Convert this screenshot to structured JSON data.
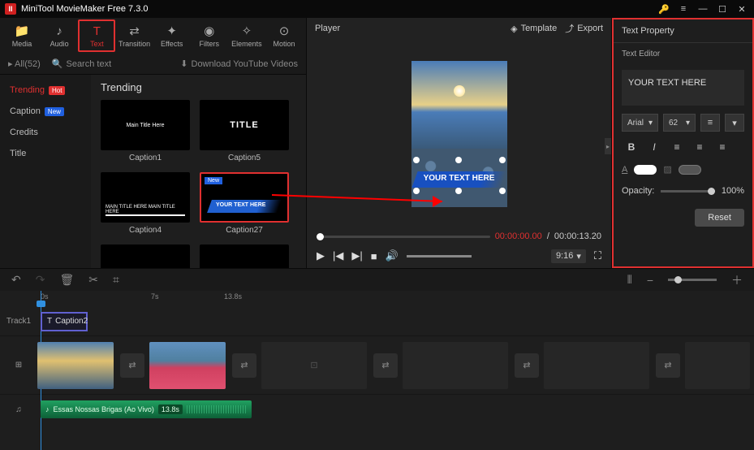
{
  "title": "MiniTool MovieMaker Free 7.3.0",
  "toolbar": [
    {
      "icon": "📁",
      "label": "Media"
    },
    {
      "icon": "♪",
      "label": "Audio"
    },
    {
      "icon": "T",
      "label": "Text"
    },
    {
      "icon": "⇄",
      "label": "Transition"
    },
    {
      "icon": "✦",
      "label": "Effects"
    },
    {
      "icon": "◉",
      "label": "Filters"
    },
    {
      "icon": "✧",
      "label": "Elements"
    },
    {
      "icon": "⊙",
      "label": "Motion"
    }
  ],
  "subbar": {
    "all": "All(52)",
    "search": "Search text",
    "dyt": "Download YouTube Videos"
  },
  "cats": [
    {
      "label": "Trending",
      "badge": "Hot",
      "badgeClass": "hot",
      "active": true
    },
    {
      "label": "Caption",
      "badge": "New",
      "badgeClass": "new"
    },
    {
      "label": "Credits"
    },
    {
      "label": "Title"
    }
  ],
  "libTitle": "Trending",
  "templates": {
    "c1": "Caption1",
    "c5": "Caption5",
    "c4": "Caption4",
    "c27": "Caption27",
    "newTag": "New",
    "bannerText": "YOUR TEXT HERE",
    "titleText": "TITLE"
  },
  "player": {
    "label": "Player",
    "template": "Template",
    "export": "Export",
    "overlayText": "YOUR TEXT HERE",
    "timeCur": "00:00:00.00",
    "timeTot": "00:00:13.20",
    "aspect": "9:16"
  },
  "prop": {
    "title": "Text Property",
    "editor": "Text Editor",
    "editorText": "YOUR TEXT HERE",
    "font": "Arial",
    "size": "62",
    "opacity": "Opacity:",
    "opVal": "100%",
    "reset": "Reset"
  },
  "timeline": {
    "ticks": [
      "0s",
      "7s",
      "13.8s"
    ],
    "track1": "Track1",
    "textClip": "Caption2",
    "audioClip": "Essas Nossas Brigas (Ao Vivo)",
    "audioDur": "13.8s"
  }
}
